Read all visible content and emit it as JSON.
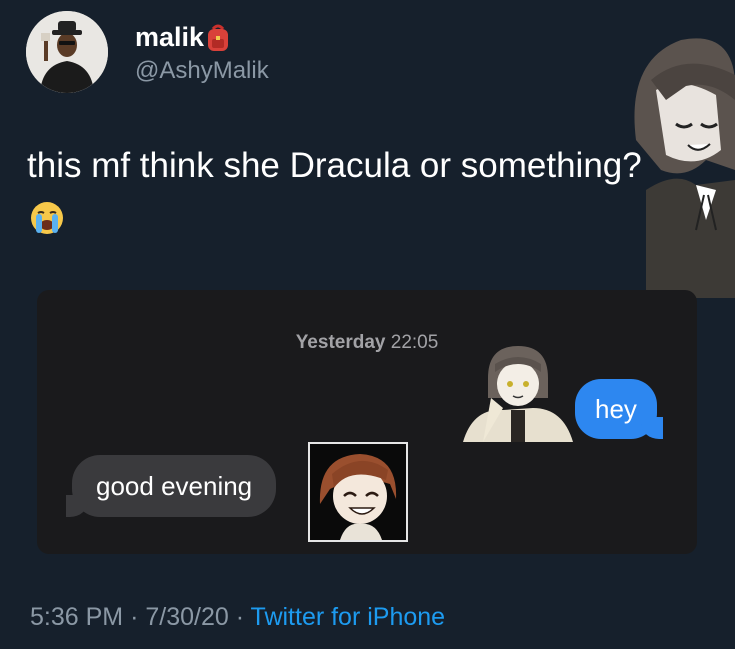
{
  "author": {
    "display_name": "malik",
    "badge_icon": "red-backpack-emoji",
    "handle": "@AshyMalik"
  },
  "tweet": {
    "text": "this mf think she Dracula or something?",
    "emoji": "loudly-crying-face"
  },
  "embedded_screenshot": {
    "timestamp_day": "Yesterday",
    "timestamp_time": "22:05",
    "messages": [
      {
        "direction": "outgoing",
        "text": "hey"
      },
      {
        "direction": "incoming",
        "text": "good evening"
      }
    ],
    "bubble_colors": {
      "outgoing": "#2d87f0",
      "incoming": "#3a3a3d"
    }
  },
  "footer": {
    "time": "5:36 PM",
    "date": "7/30/20",
    "sep": "·",
    "source": "Twitter for iPhone"
  },
  "colors": {
    "background": "#16202c",
    "secondary_text": "#8b98a5",
    "link": "#1d9bf0"
  }
}
